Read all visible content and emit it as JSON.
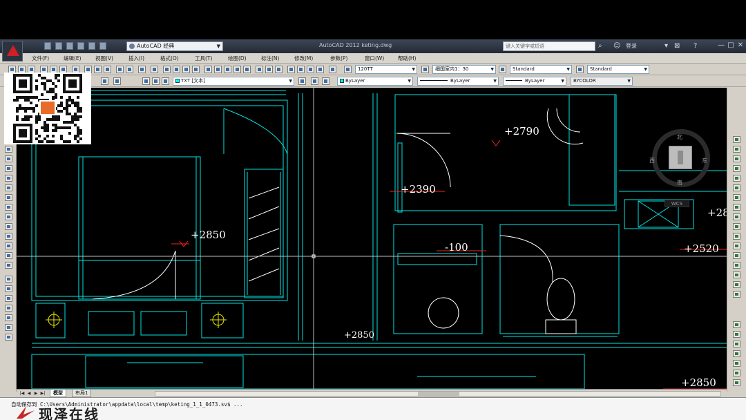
{
  "window": {
    "title": "AutoCAD 2012   keting.dwg",
    "workspace": "AutoCAD 经典",
    "search_placeholder": "键入关键字或短语",
    "user": "登录",
    "controls": [
      "—",
      "□",
      "✕"
    ]
  },
  "menu": [
    "文件(F)",
    "编辑(E)",
    "视图(V)",
    "插入(I)",
    "格式(O)",
    "工具(T)",
    "绘图(D)",
    "标注(N)",
    "修改(M)",
    "参数(P)",
    "窗口(W)",
    "帮助(H)"
  ],
  "toolbar1": {
    "text_style": "120TT",
    "dim_style": "细国室内1：30",
    "table_style": "Standard",
    "multileader_style": "Standard"
  },
  "toolbar2": {
    "layer": "TXT  [文本]",
    "color": "ByLayer",
    "linetype": "ByLayer",
    "lineweight": "ByLayer",
    "plot_style": "BYCOLOR"
  },
  "drawing": {
    "dimensions": [
      "+2790",
      "+2390",
      "+2850",
      "-100",
      "+2850",
      "+2520",
      "+2850",
      "+28"
    ],
    "compass": {
      "north": "北",
      "south": "南",
      "east": "东",
      "west": "西"
    },
    "wcs": "WCS"
  },
  "tabs": {
    "model": "模型",
    "layout": "布局1"
  },
  "command": {
    "line1": "自动保存到 C:\\Users\\Administrator\\appdata\\local\\temp\\keting_1_1_0473.sv$ ..."
  },
  "watermark": "现泽在线",
  "colors": {
    "cyan": "#00e5e5",
    "white": "#ffffff",
    "red": "#ff2020",
    "yellow": "#e8e800",
    "background": "#000000"
  }
}
